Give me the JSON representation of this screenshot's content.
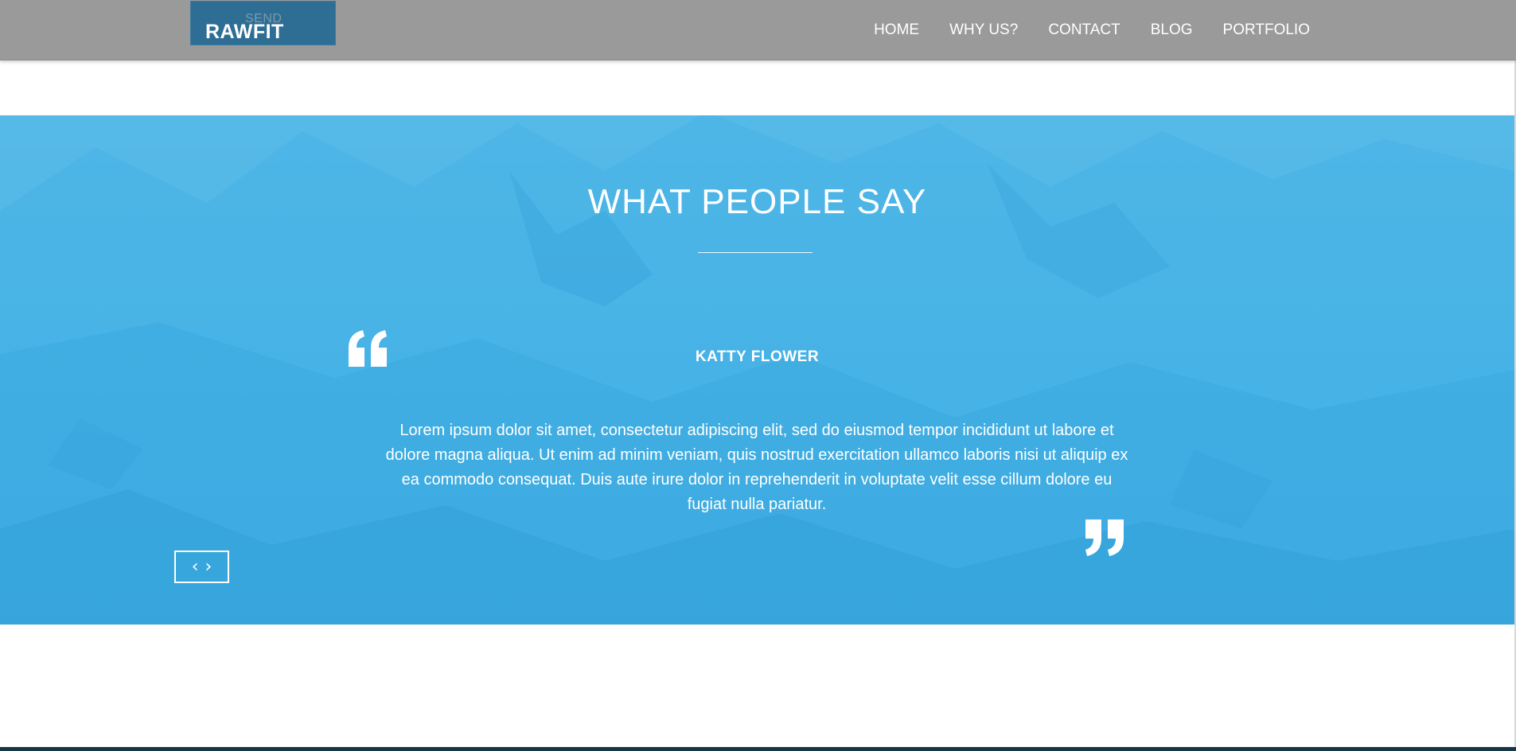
{
  "header": {
    "logo": {
      "small_text": "SEND",
      "main_text": "RAWFIT"
    },
    "nav": [
      {
        "label": "HOME"
      },
      {
        "label": "WHY US?"
      },
      {
        "label": "CONTACT"
      },
      {
        "label": "BLOG"
      },
      {
        "label": "PORTFOLIO"
      }
    ]
  },
  "testimonial": {
    "title": "WHAT PEOPLE SAY",
    "author": "KATTY FLOWER",
    "quote": "Lorem ipsum dolor sit amet, consectetur adipiscing elit, sed do eiusmod tempor incididunt ut labore et dolore magna aliqua. Ut enim ad minim veniam, quis nostrud exercitation ullamco laboris nisi ut aliquip ex ea commodo consequat. Duis aute irure dolor in reprehenderit in voluptate velit esse cillum dolore eu fugiat nulla pariatur.",
    "prev_icon": "chevron-left-icon",
    "next_icon": "chevron-right-icon",
    "quote_open_icon": "quote-open-icon",
    "quote_close_icon": "quote-close-icon"
  },
  "colors": {
    "header_bg": "#9a9a9a",
    "logo_bg": "#2e6e94",
    "section_bg": "#3eaee5",
    "text": "#ffffff"
  }
}
